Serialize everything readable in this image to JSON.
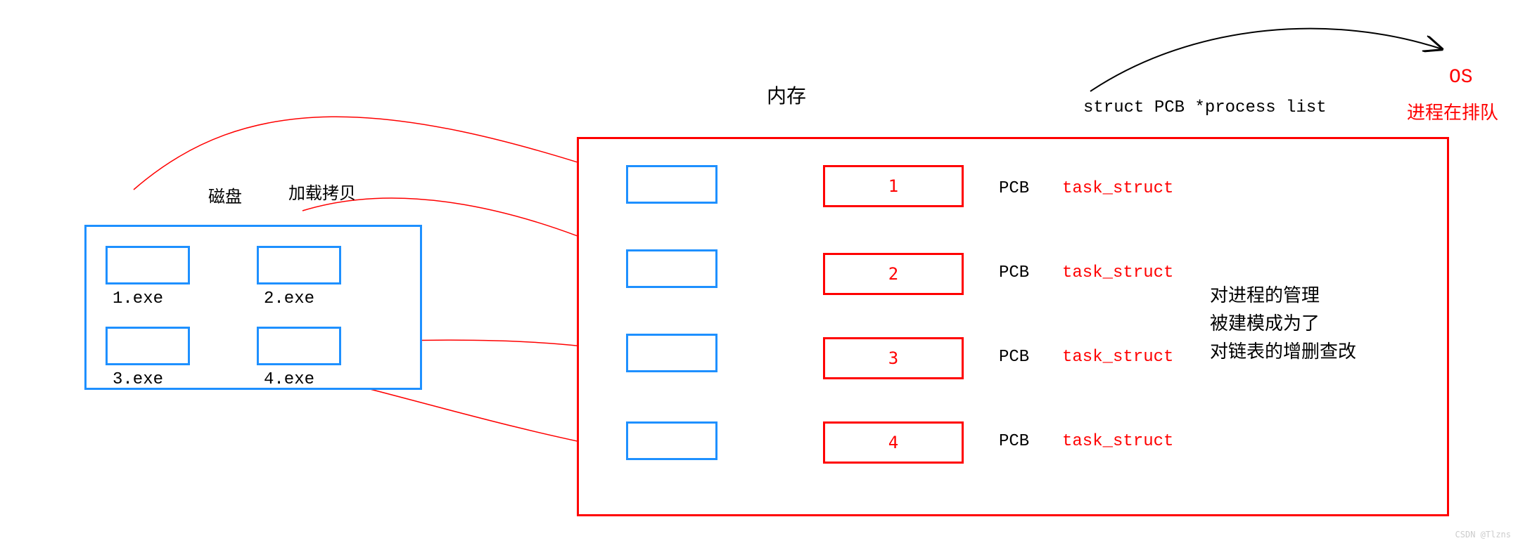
{
  "disk": {
    "label": "磁盘",
    "action_label": "加载拷贝",
    "files": [
      "1.exe",
      "2.exe",
      "3.exe",
      "4.exe"
    ]
  },
  "memory": {
    "label": "内存",
    "pcb_label": "PCB",
    "pcb_items": [
      {
        "num": "1",
        "struct": "task_struct"
      },
      {
        "num": "2",
        "struct": "task_struct"
      },
      {
        "num": "3",
        "struct": "task_struct"
      },
      {
        "num": "4",
        "struct": "task_struct"
      }
    ]
  },
  "top_right": {
    "struct_text": "struct PCB *process list",
    "os_label": "OS",
    "queue_label": "进程在排队"
  },
  "note": {
    "line1": "对进程的管理",
    "line2": "被建模成为了",
    "line3": "对链表的增删查改"
  },
  "watermark": "CSDN @Tlzns"
}
